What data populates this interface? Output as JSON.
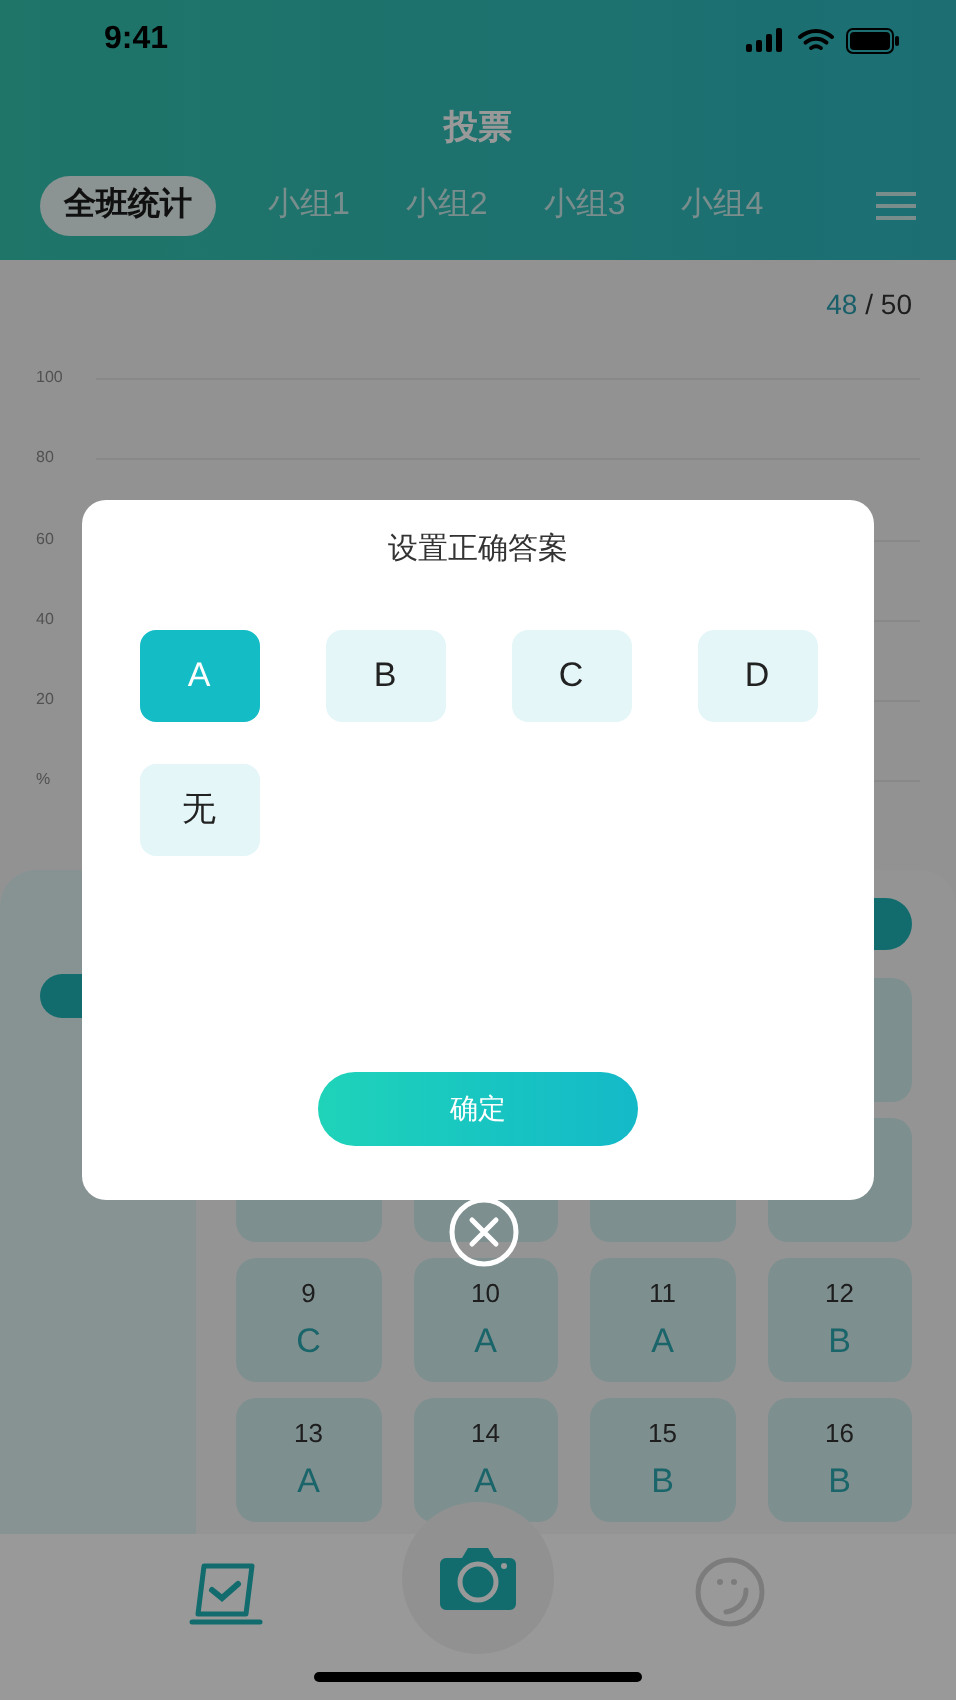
{
  "status_bar": {
    "time": "9:41"
  },
  "header": {
    "title": "投票"
  },
  "tabs": [
    {
      "label": "全班统计",
      "selected": true
    },
    {
      "label": "小组1",
      "selected": false
    },
    {
      "label": "小组2",
      "selected": false
    },
    {
      "label": "小组3",
      "selected": false
    },
    {
      "label": "小组4",
      "selected": false
    }
  ],
  "count": {
    "submitted": "48",
    "total": "/ 50"
  },
  "chart": {
    "y_ticks": [
      "100",
      "80",
      "60",
      "40",
      "20",
      "%"
    ]
  },
  "answers": [
    {
      "number": "9",
      "answer": "C"
    },
    {
      "number": "10",
      "answer": "A"
    },
    {
      "number": "11",
      "answer": "A"
    },
    {
      "number": "12",
      "answer": "B"
    },
    {
      "number": "13",
      "answer": "A"
    },
    {
      "number": "14",
      "answer": "A"
    },
    {
      "number": "15",
      "answer": "B"
    },
    {
      "number": "16",
      "answer": "B"
    }
  ],
  "nav": [
    {
      "kind": "check",
      "selected": true
    },
    {
      "kind": "camera",
      "selected": false
    },
    {
      "kind": "smiley",
      "selected": false
    }
  ],
  "dialog": {
    "title": "设置正确答案",
    "options": [
      {
        "label": "A",
        "selected": true
      },
      {
        "label": "B",
        "selected": false
      },
      {
        "label": "C",
        "selected": false
      },
      {
        "label": "D",
        "selected": false
      },
      {
        "label": "无",
        "selected": false
      }
    ],
    "confirm": "确定"
  }
}
